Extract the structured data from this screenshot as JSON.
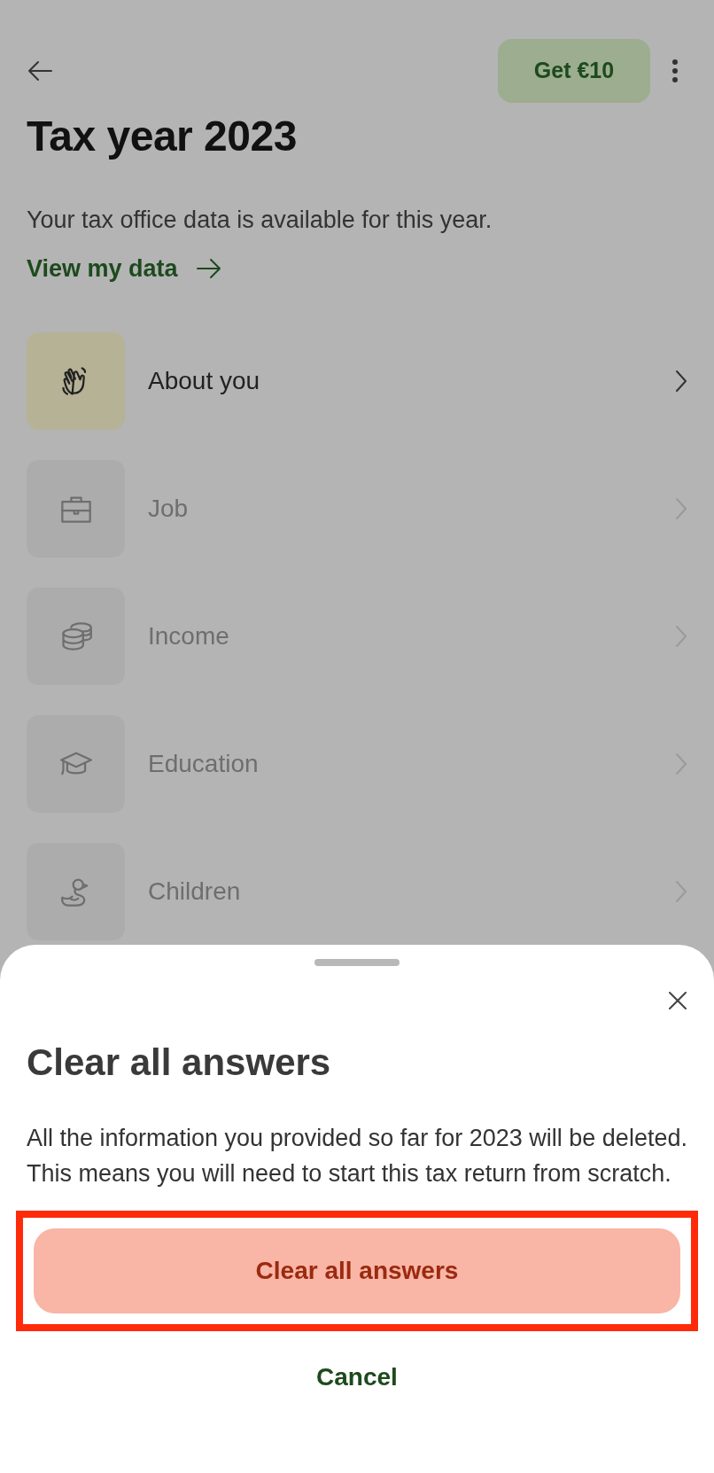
{
  "header": {
    "promo_button": "Get €10"
  },
  "title": "Tax year 2023",
  "notice": "Your tax office data is available for this year.",
  "link": "View my data",
  "sections": [
    {
      "label": "About you",
      "disabled": false
    },
    {
      "label": "Job",
      "disabled": true
    },
    {
      "label": "Income",
      "disabled": true
    },
    {
      "label": "Education",
      "disabled": true
    },
    {
      "label": "Children",
      "disabled": true
    }
  ],
  "sheet": {
    "title": "Clear all answers",
    "message": "All the information you provided so far for 2023 will be deleted. This means you will need to start this tax return from scratch.",
    "confirm_button": {
      "label": "Clear all answers",
      "highlighted": true
    },
    "cancel_button": "Cancel"
  }
}
